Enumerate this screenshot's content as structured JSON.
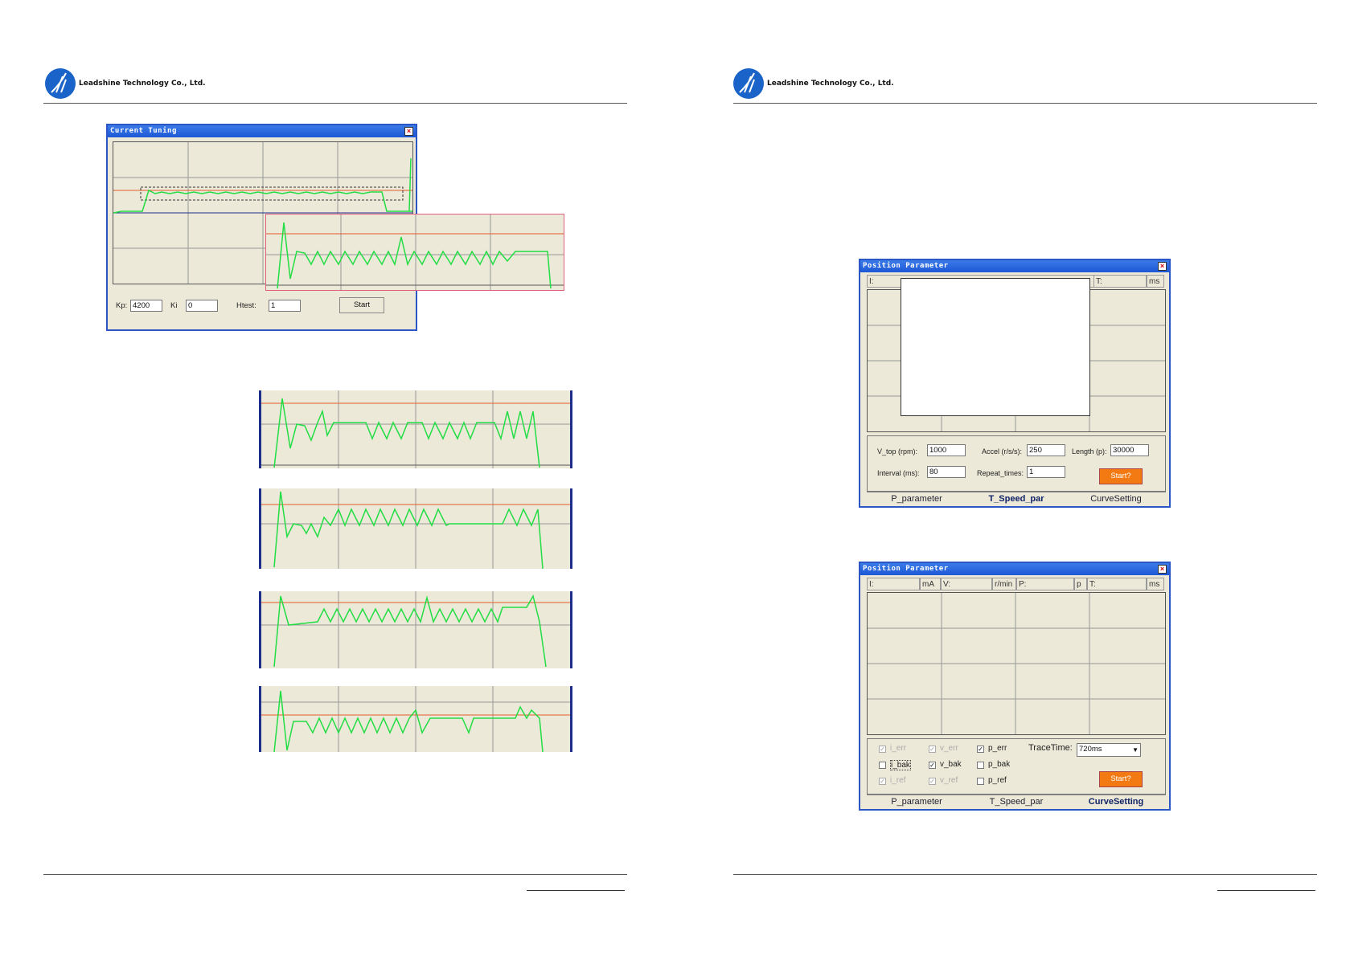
{
  "company_name": "Leadshine Technology Co., Ltd.",
  "current_tuning": {
    "title": "Current Tuning",
    "kp_label": "Kp:",
    "kp_value": "4200",
    "ki_label": "Ki",
    "ki_value": "0",
    "htest_label": "Htest:",
    "htest_value": "1",
    "start_label": "Start"
  },
  "pos1": {
    "title": "Position Parameter",
    "hdr_i": "I:",
    "hdr_t": "T:",
    "hdr_ms": "ms",
    "vtop_label": "V_top (rpm):",
    "vtop_value": "1000",
    "accel_label": "Accel (r/s/s):",
    "accel_value": "250",
    "length_label": "Length (p):",
    "length_value": "30000",
    "interval_label": "Interval (ms):",
    "interval_value": "80",
    "repeat_label": "Repeat_times:",
    "repeat_value": "1",
    "start_label": "Start?",
    "tabs": [
      "P_parameter",
      "T_Speed_par",
      "CurveSetting"
    ]
  },
  "pos2": {
    "title": "Position Parameter",
    "hdr": [
      "I:",
      "mA",
      "V:",
      "r/min",
      "P:",
      "p",
      "T:",
      "ms"
    ],
    "checks": [
      {
        "label": "i_err",
        "checked": true,
        "disabled": true
      },
      {
        "label": "v_err",
        "checked": true,
        "disabled": true
      },
      {
        "label": "p_err",
        "checked": true,
        "disabled": false
      },
      {
        "label": "i_bak",
        "checked": false,
        "disabled": false
      },
      {
        "label": "v_bak",
        "checked": true,
        "disabled": false
      },
      {
        "label": "p_bak",
        "checked": false,
        "disabled": false
      },
      {
        "label": "i_ref",
        "checked": true,
        "disabled": true
      },
      {
        "label": "v_ref",
        "checked": true,
        "disabled": true
      },
      {
        "label": "p_ref",
        "checked": false,
        "disabled": false
      }
    ],
    "tracetime_label": "TraceTime:",
    "tracetime_value": "720ms",
    "start_label": "Start?",
    "tabs": [
      "P_parameter",
      "T_Speed_par",
      "CurveSetting"
    ]
  }
}
